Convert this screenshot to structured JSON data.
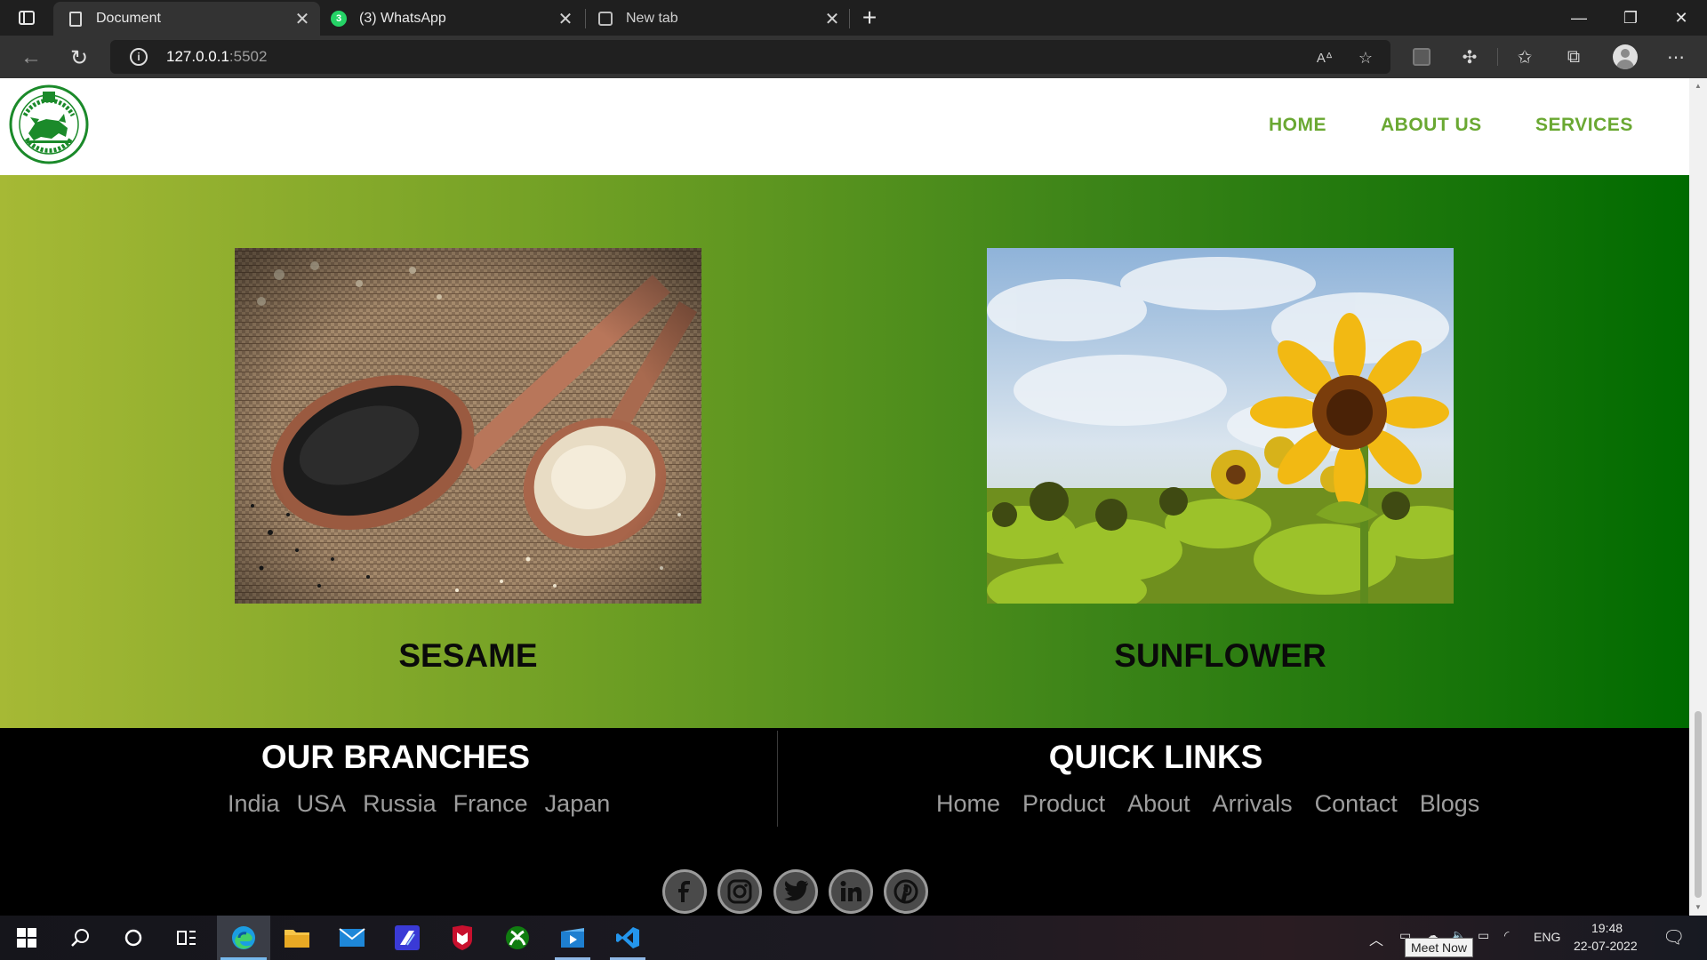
{
  "browser": {
    "tabs": [
      {
        "title": "Document",
        "icon": "document-icon",
        "active": true
      },
      {
        "title": "(3) WhatsApp",
        "icon": "whatsapp-icon",
        "badge": "3",
        "active": false
      },
      {
        "title": "New tab",
        "icon": "new-tab-page-icon",
        "active": false
      }
    ],
    "address": {
      "host": "127.0.0.1",
      "port": ":5502"
    }
  },
  "site": {
    "nav": [
      {
        "label": "HOME"
      },
      {
        "label": "ABOUT US"
      },
      {
        "label": "SERVICES"
      }
    ],
    "products": [
      {
        "name": "SESAME",
        "image": "sesame-seeds-in-wooden-spoons"
      },
      {
        "name": "SUNFLOWER",
        "image": "sunflower-field"
      }
    ],
    "footer": {
      "branches": {
        "heading": "OUR BRANCHES",
        "items": [
          "India",
          "USA",
          "Russia",
          "France",
          "Japan"
        ]
      },
      "quick_links": {
        "heading": "QUICK LINKS",
        "items": [
          "Home",
          "Product",
          "About",
          "Arrivals",
          "Contact",
          "Blogs"
        ]
      },
      "social": [
        "facebook-icon",
        "instagram-icon",
        "twitter-icon",
        "linkedin-icon",
        "pinterest-icon"
      ]
    },
    "colors": {
      "nav_link": "#6aa832",
      "gradient_start": "#a6b935",
      "gradient_end": "#006b00"
    }
  },
  "taskbar": {
    "language": "ENG",
    "time": "19:48",
    "date": "22-07-2022",
    "tooltip": "Meet Now"
  }
}
